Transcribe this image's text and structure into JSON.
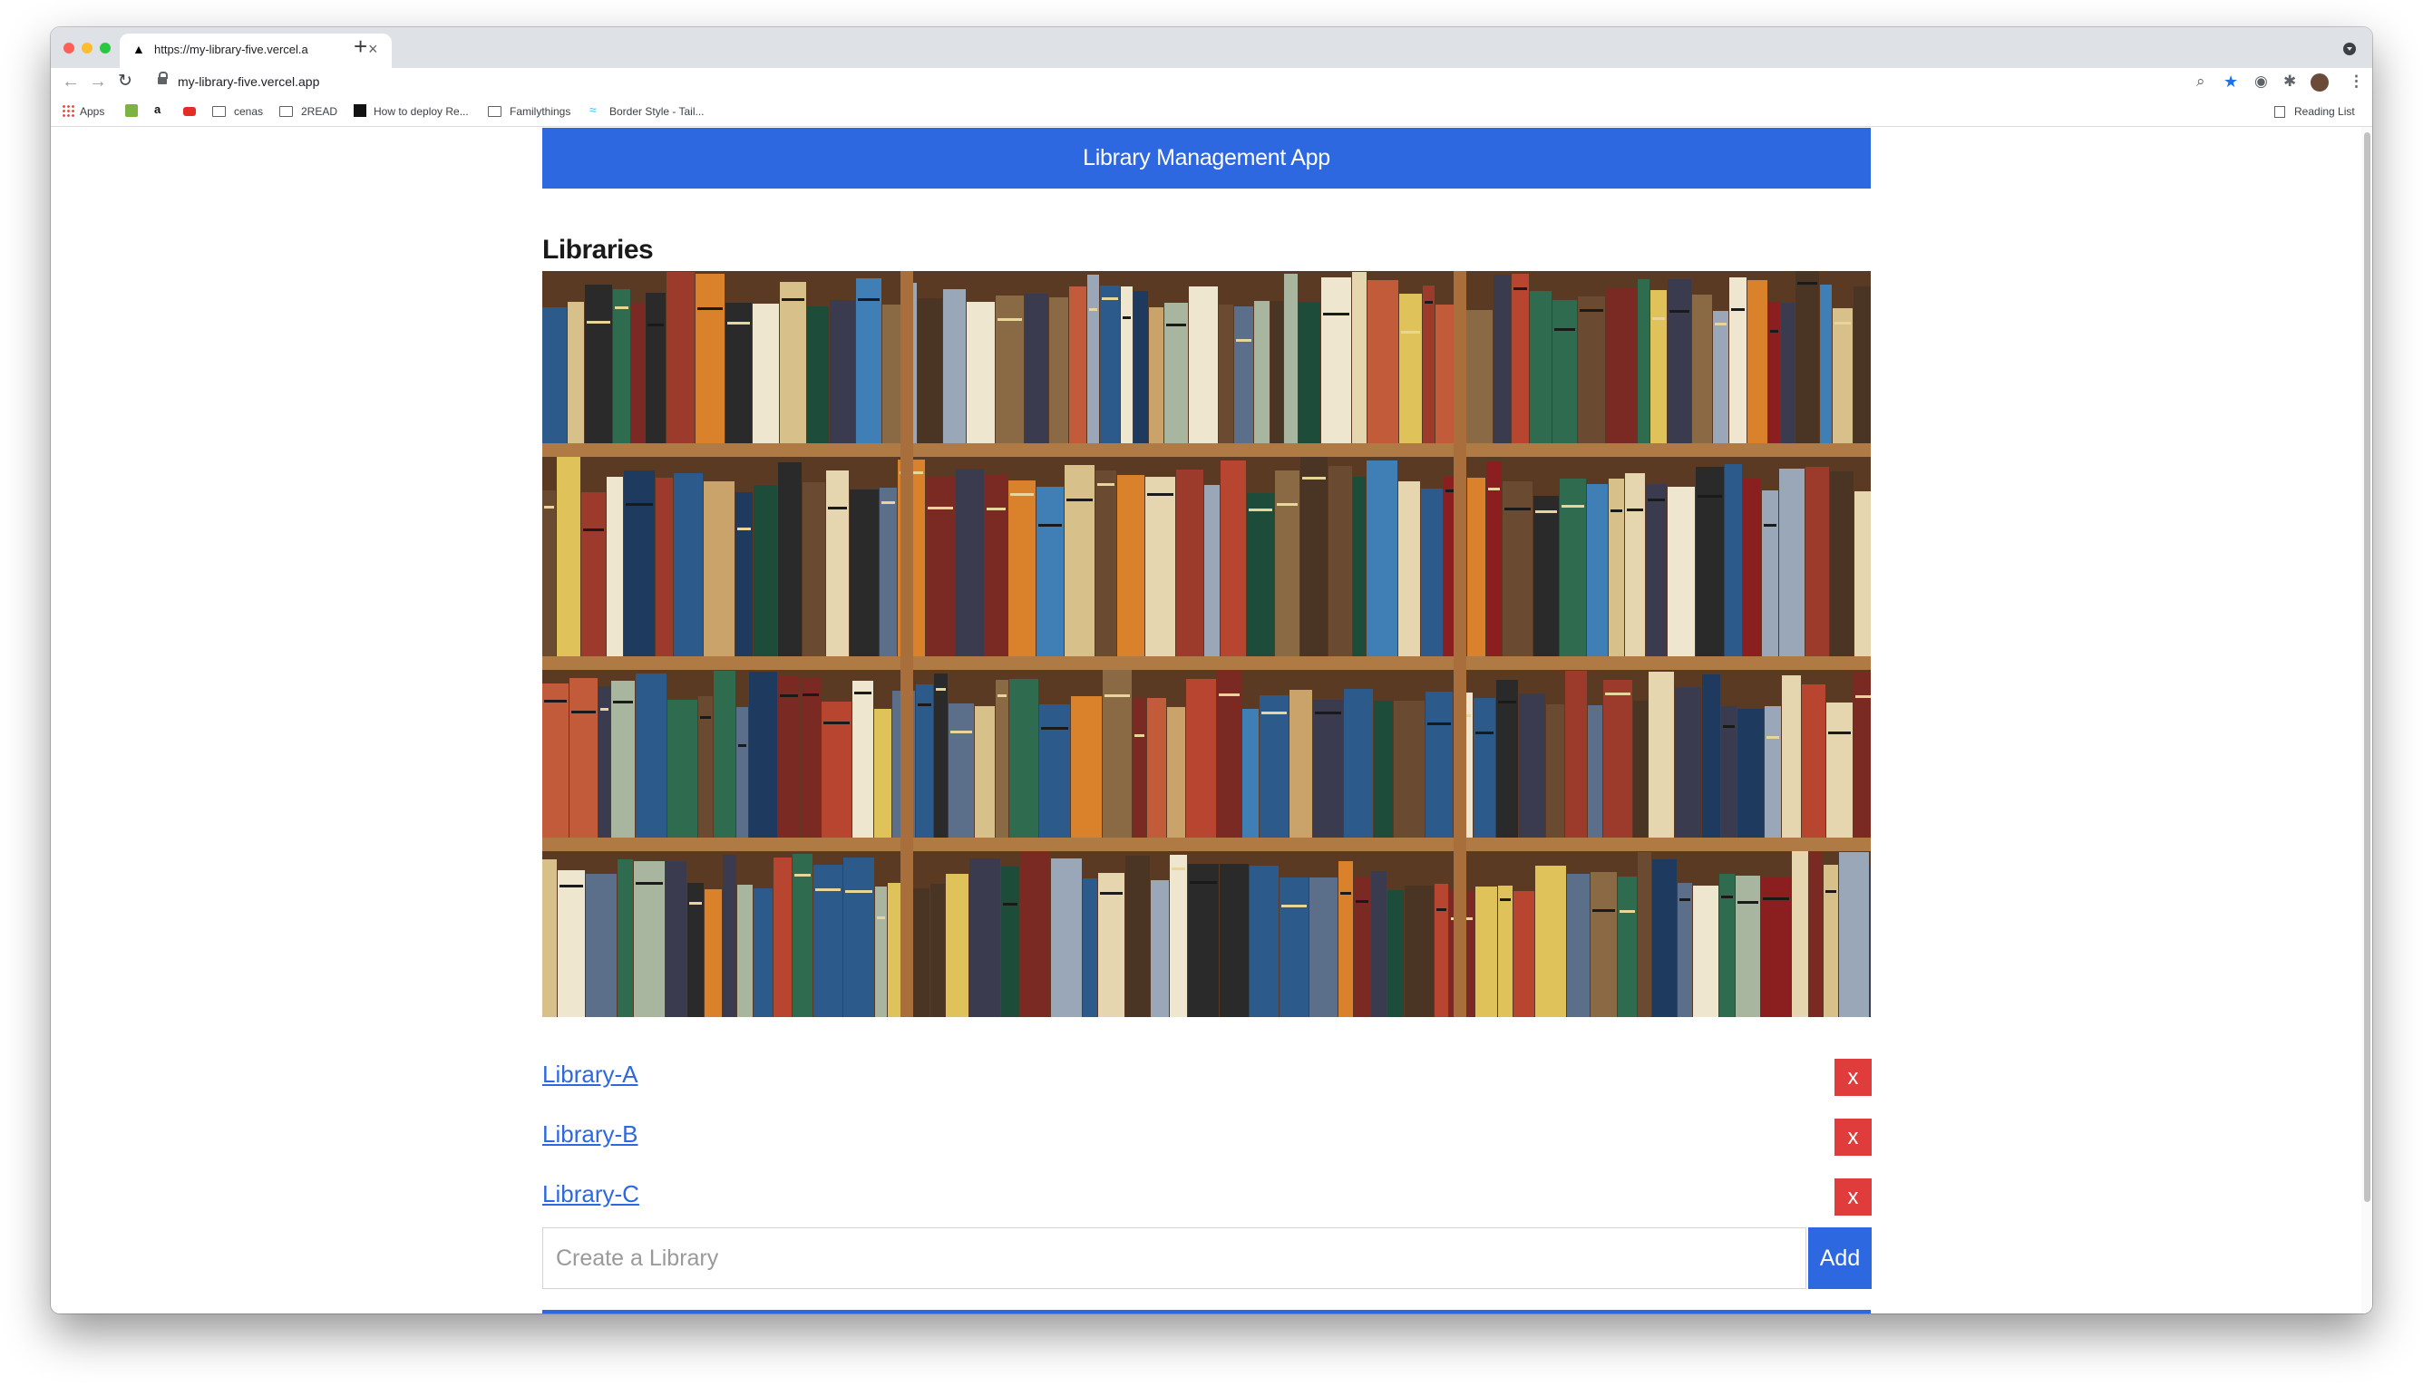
{
  "browser": {
    "tab_title": "https://my-library-five.vercel.a",
    "tab_favicon": "▲",
    "url": "my-library-five.vercel.app",
    "bookmarks": [
      {
        "label": "Apps",
        "icon": "apps-grid-icon"
      },
      {
        "label": "",
        "icon": "green-square-icon"
      },
      {
        "label": "",
        "icon": "amazon-icon"
      },
      {
        "label": "",
        "icon": "youtube-icon"
      },
      {
        "label": "cenas",
        "icon": "folder-icon"
      },
      {
        "label": "2READ",
        "icon": "folder-icon"
      },
      {
        "label": "How to deploy Re...",
        "icon": "dev-icon"
      },
      {
        "label": "Familythings",
        "icon": "folder-icon"
      },
      {
        "label": "Border Style - Tail...",
        "icon": "tailwind-icon"
      }
    ],
    "reading_list": "Reading List"
  },
  "app": {
    "header_title": "Library Management App",
    "section_title": "Libraries",
    "hero_image": "bookshelf-photo",
    "libraries": [
      {
        "name": "Library-A",
        "delete_label": "x"
      },
      {
        "name": "Library-B",
        "delete_label": "x"
      },
      {
        "name": "Library-C",
        "delete_label": "x"
      }
    ],
    "create_input": {
      "value": "",
      "placeholder": "Create a Library"
    },
    "add_label": "Add"
  },
  "colors": {
    "primary": "#2d68e0",
    "danger": "#e03c3c"
  }
}
